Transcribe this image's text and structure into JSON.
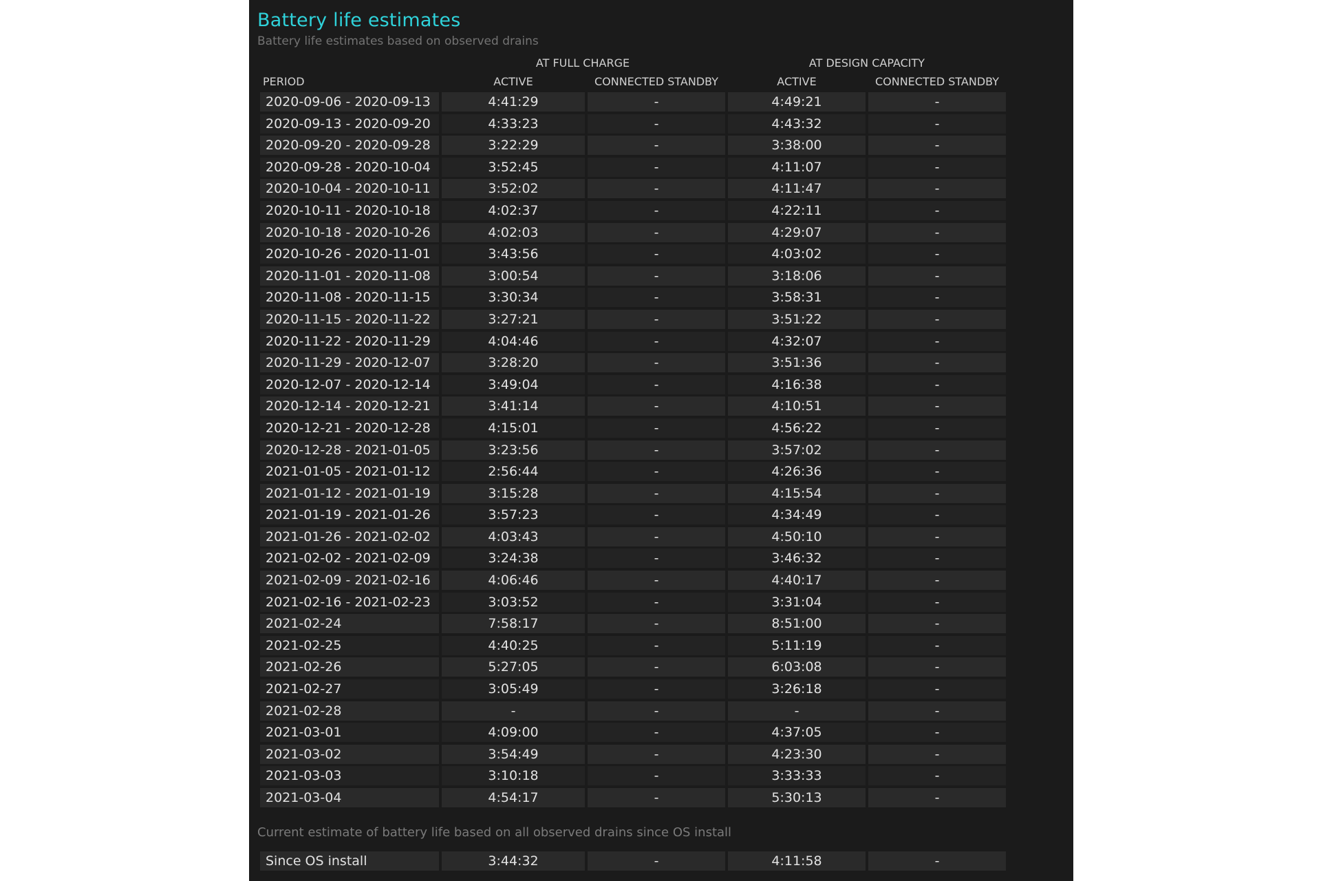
{
  "section": {
    "title": "Battery life estimates",
    "subtitle": "Battery life estimates based on observed drains"
  },
  "columns": {
    "group_full": "AT FULL CHARGE",
    "group_design": "AT DESIGN CAPACITY",
    "period": "PERIOD",
    "full_active": "ACTIVE",
    "full_standby": "CONNECTED STANDBY",
    "design_active": "ACTIVE",
    "design_standby": "CONNECTED STANDBY"
  },
  "rows": [
    {
      "period": "2020-09-06 - 2020-09-13",
      "full_active": "4:41:29",
      "full_standby": "-",
      "design_active": "4:49:21",
      "design_standby": "-"
    },
    {
      "period": "2020-09-13 - 2020-09-20",
      "full_active": "4:33:23",
      "full_standby": "-",
      "design_active": "4:43:32",
      "design_standby": "-"
    },
    {
      "period": "2020-09-20 - 2020-09-28",
      "full_active": "3:22:29",
      "full_standby": "-",
      "design_active": "3:38:00",
      "design_standby": "-"
    },
    {
      "period": "2020-09-28 - 2020-10-04",
      "full_active": "3:52:45",
      "full_standby": "-",
      "design_active": "4:11:07",
      "design_standby": "-"
    },
    {
      "period": "2020-10-04 - 2020-10-11",
      "full_active": "3:52:02",
      "full_standby": "-",
      "design_active": "4:11:47",
      "design_standby": "-"
    },
    {
      "period": "2020-10-11 - 2020-10-18",
      "full_active": "4:02:37",
      "full_standby": "-",
      "design_active": "4:22:11",
      "design_standby": "-"
    },
    {
      "period": "2020-10-18 - 2020-10-26",
      "full_active": "4:02:03",
      "full_standby": "-",
      "design_active": "4:29:07",
      "design_standby": "-"
    },
    {
      "period": "2020-10-26 - 2020-11-01",
      "full_active": "3:43:56",
      "full_standby": "-",
      "design_active": "4:03:02",
      "design_standby": "-"
    },
    {
      "period": "2020-11-01 - 2020-11-08",
      "full_active": "3:00:54",
      "full_standby": "-",
      "design_active": "3:18:06",
      "design_standby": "-"
    },
    {
      "period": "2020-11-08 - 2020-11-15",
      "full_active": "3:30:34",
      "full_standby": "-",
      "design_active": "3:58:31",
      "design_standby": "-"
    },
    {
      "period": "2020-11-15 - 2020-11-22",
      "full_active": "3:27:21",
      "full_standby": "-",
      "design_active": "3:51:22",
      "design_standby": "-"
    },
    {
      "period": "2020-11-22 - 2020-11-29",
      "full_active": "4:04:46",
      "full_standby": "-",
      "design_active": "4:32:07",
      "design_standby": "-"
    },
    {
      "period": "2020-11-29 - 2020-12-07",
      "full_active": "3:28:20",
      "full_standby": "-",
      "design_active": "3:51:36",
      "design_standby": "-"
    },
    {
      "period": "2020-12-07 - 2020-12-14",
      "full_active": "3:49:04",
      "full_standby": "-",
      "design_active": "4:16:38",
      "design_standby": "-"
    },
    {
      "period": "2020-12-14 - 2020-12-21",
      "full_active": "3:41:14",
      "full_standby": "-",
      "design_active": "4:10:51",
      "design_standby": "-"
    },
    {
      "period": "2020-12-21 - 2020-12-28",
      "full_active": "4:15:01",
      "full_standby": "-",
      "design_active": "4:56:22",
      "design_standby": "-"
    },
    {
      "period": "2020-12-28 - 2021-01-05",
      "full_active": "3:23:56",
      "full_standby": "-",
      "design_active": "3:57:02",
      "design_standby": "-"
    },
    {
      "period": "2021-01-05 - 2021-01-12",
      "full_active": "2:56:44",
      "full_standby": "-",
      "design_active": "4:26:36",
      "design_standby": "-"
    },
    {
      "period": "2021-01-12 - 2021-01-19",
      "full_active": "3:15:28",
      "full_standby": "-",
      "design_active": "4:15:54",
      "design_standby": "-"
    },
    {
      "period": "2021-01-19 - 2021-01-26",
      "full_active": "3:57:23",
      "full_standby": "-",
      "design_active": "4:34:49",
      "design_standby": "-"
    },
    {
      "period": "2021-01-26 - 2021-02-02",
      "full_active": "4:03:43",
      "full_standby": "-",
      "design_active": "4:50:10",
      "design_standby": "-"
    },
    {
      "period": "2021-02-02 - 2021-02-09",
      "full_active": "3:24:38",
      "full_standby": "-",
      "design_active": "3:46:32",
      "design_standby": "-"
    },
    {
      "period": "2021-02-09 - 2021-02-16",
      "full_active": "4:06:46",
      "full_standby": "-",
      "design_active": "4:40:17",
      "design_standby": "-"
    },
    {
      "period": "2021-02-16 - 2021-02-23",
      "full_active": "3:03:52",
      "full_standby": "-",
      "design_active": "3:31:04",
      "design_standby": "-"
    },
    {
      "period": "2021-02-24",
      "full_active": "7:58:17",
      "full_standby": "-",
      "design_active": "8:51:00",
      "design_standby": "-"
    },
    {
      "period": "2021-02-25",
      "full_active": "4:40:25",
      "full_standby": "-",
      "design_active": "5:11:19",
      "design_standby": "-"
    },
    {
      "period": "2021-02-26",
      "full_active": "5:27:05",
      "full_standby": "-",
      "design_active": "6:03:08",
      "design_standby": "-"
    },
    {
      "period": "2021-02-27",
      "full_active": "3:05:49",
      "full_standby": "-",
      "design_active": "3:26:18",
      "design_standby": "-"
    },
    {
      "period": "2021-02-28",
      "full_active": "-",
      "full_standby": "-",
      "design_active": "-",
      "design_standby": "-"
    },
    {
      "period": "2021-03-01",
      "full_active": "4:09:00",
      "full_standby": "-",
      "design_active": "4:37:05",
      "design_standby": "-"
    },
    {
      "period": "2021-03-02",
      "full_active": "3:54:49",
      "full_standby": "-",
      "design_active": "4:23:30",
      "design_standby": "-"
    },
    {
      "period": "2021-03-03",
      "full_active": "3:10:18",
      "full_standby": "-",
      "design_active": "3:33:33",
      "design_standby": "-"
    },
    {
      "period": "2021-03-04",
      "full_active": "4:54:17",
      "full_standby": "-",
      "design_active": "5:30:13",
      "design_standby": "-"
    }
  ],
  "summary": {
    "caption": "Current estimate of battery life based on all observed drains since OS install",
    "row": {
      "period": "Since OS install",
      "full_active": "3:44:32",
      "full_standby": "-",
      "design_active": "4:11:58",
      "design_standby": "-"
    }
  }
}
